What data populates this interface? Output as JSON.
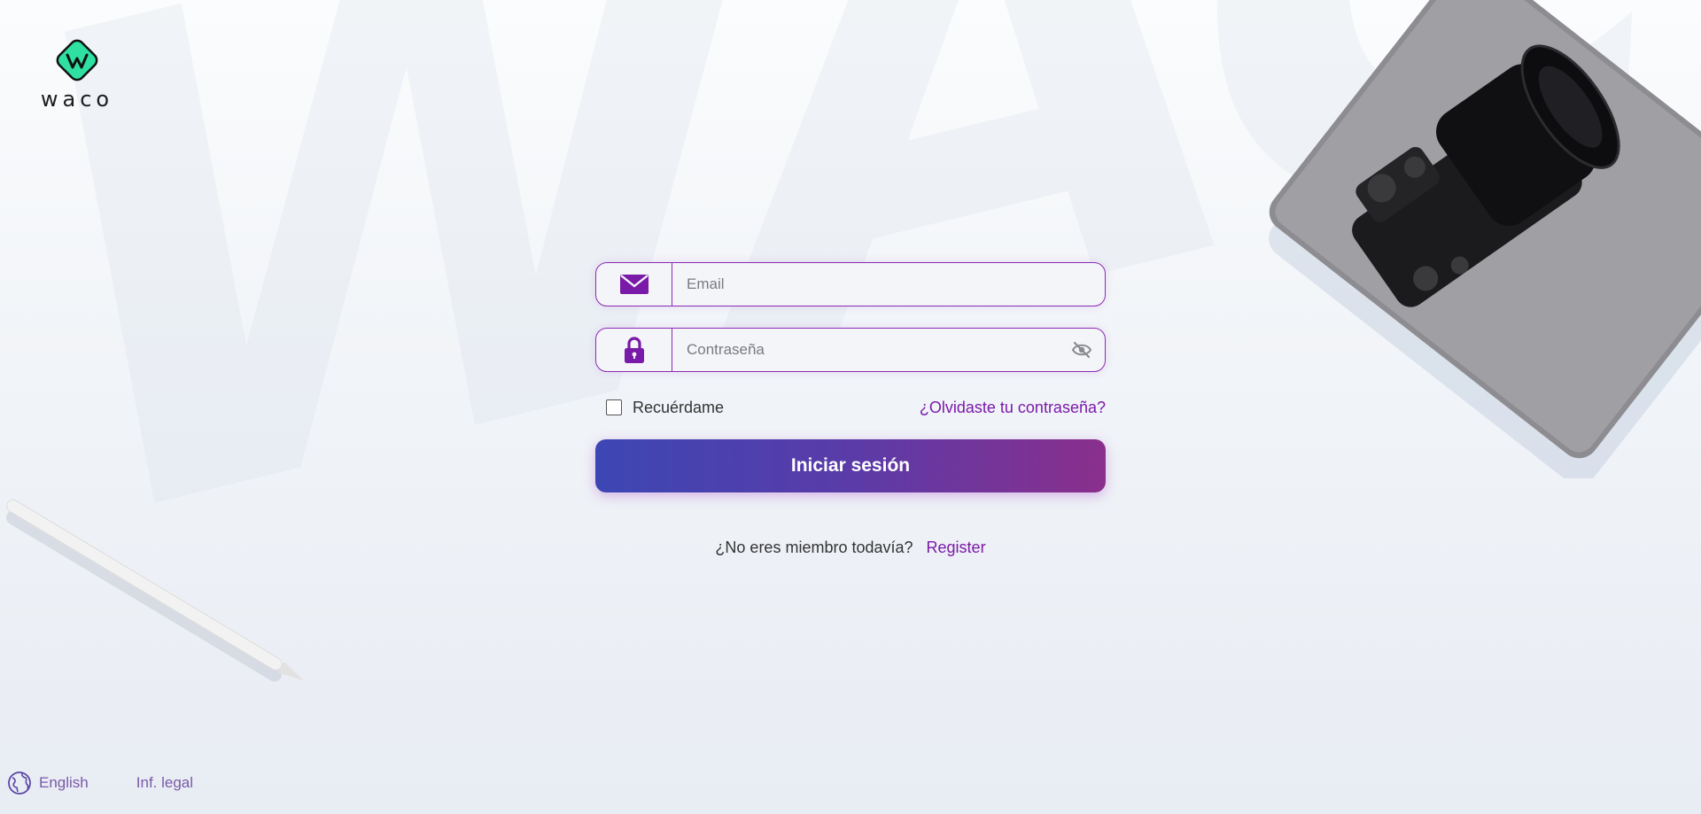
{
  "brand": {
    "name": "waco",
    "watermark_text": "WACO",
    "accent": "#8b2cb4",
    "link_color": "#7a1aa8",
    "logo_color": "#2fe0a2"
  },
  "login_form": {
    "email_placeholder": "Email",
    "email_icon": "envelope-icon",
    "password_placeholder": "Contraseña",
    "password_icon": "lock-icon",
    "toggle_visibility_icon": "eye-slash-icon",
    "remember_me_label": "Recuérdame",
    "remember_me_checked": false,
    "forgot_password_link": "¿Olvidaste tu contraseña?",
    "submit_label": "Iniciar sesión",
    "button_gradient": [
      "#3c47b4",
      "#8a2f8c"
    ]
  },
  "signup": {
    "prompt": "¿No eres miembro todavía?",
    "link": "Register"
  },
  "footer": {
    "language_icon": "globe-icon",
    "language_label": "English",
    "legal_link": "Inf. legal"
  }
}
